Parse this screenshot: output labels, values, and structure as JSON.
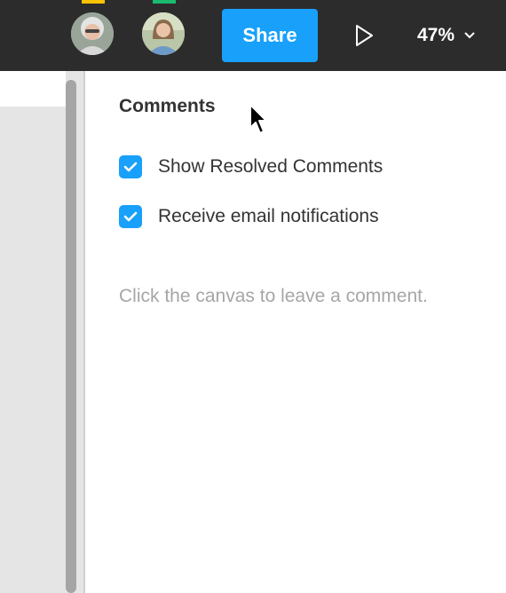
{
  "topbar": {
    "avatars": [
      {
        "name": "avatar-1",
        "marker_color": "#f9c302"
      },
      {
        "name": "avatar-2",
        "marker_color": "#1bbb6f"
      }
    ],
    "share_label": "Share",
    "share_color": "#18a0fb",
    "present_icon": "play-icon",
    "zoom": "47%",
    "zoom_icon": "chevron-down-icon"
  },
  "panel": {
    "title": "Comments",
    "options": [
      {
        "label": "Show Resolved Comments",
        "checked": true
      },
      {
        "label": "Receive email notifications",
        "checked": true
      }
    ],
    "checkbox_color": "#18a0fb",
    "hint": "Click the canvas to leave a comment."
  }
}
